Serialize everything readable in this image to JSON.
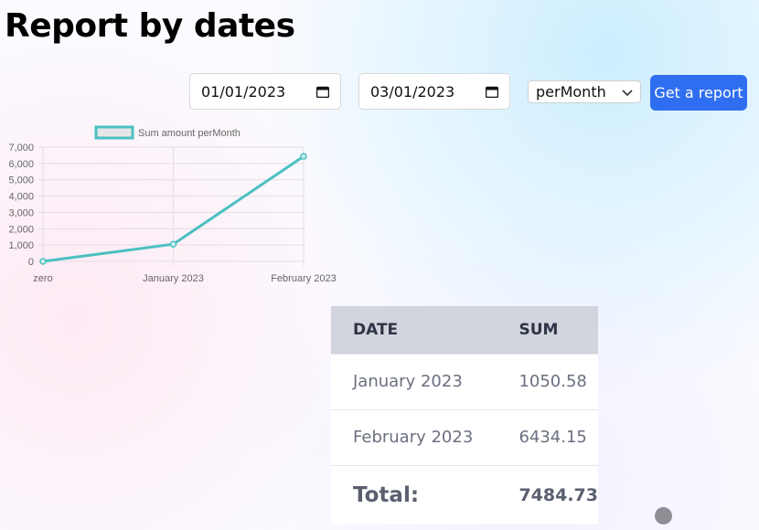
{
  "page": {
    "title": "Report by dates"
  },
  "filters": {
    "start_date": "01/01/2023",
    "end_date": "03/01/2023",
    "period_selected": "perMonth",
    "submit_label": "Get a report"
  },
  "chart_data": {
    "type": "line",
    "legend": "Sum amount perMonth",
    "categories": [
      "zero",
      "January 2023",
      "February 2023"
    ],
    "values": [
      0,
      1050.58,
      6434.15
    ],
    "ylim": [
      0,
      7000
    ],
    "yticks": [
      "7,000",
      "6,000",
      "5,000",
      "4,000",
      "3,000",
      "2,000",
      "1,000",
      "0"
    ],
    "line_color": "#4bc0c0",
    "grid": true,
    "legend_position": "top"
  },
  "table": {
    "headers": [
      "DATE",
      "SUM"
    ],
    "rows": [
      {
        "date": "January 2023",
        "sum": "1050.58"
      },
      {
        "date": "February 2023",
        "sum": "6434.15"
      }
    ],
    "total_label": "Total:",
    "total_value": "7484.73"
  },
  "colors": {
    "accent": "#2f6ef0",
    "table_header_bg": "#d2d5de"
  }
}
